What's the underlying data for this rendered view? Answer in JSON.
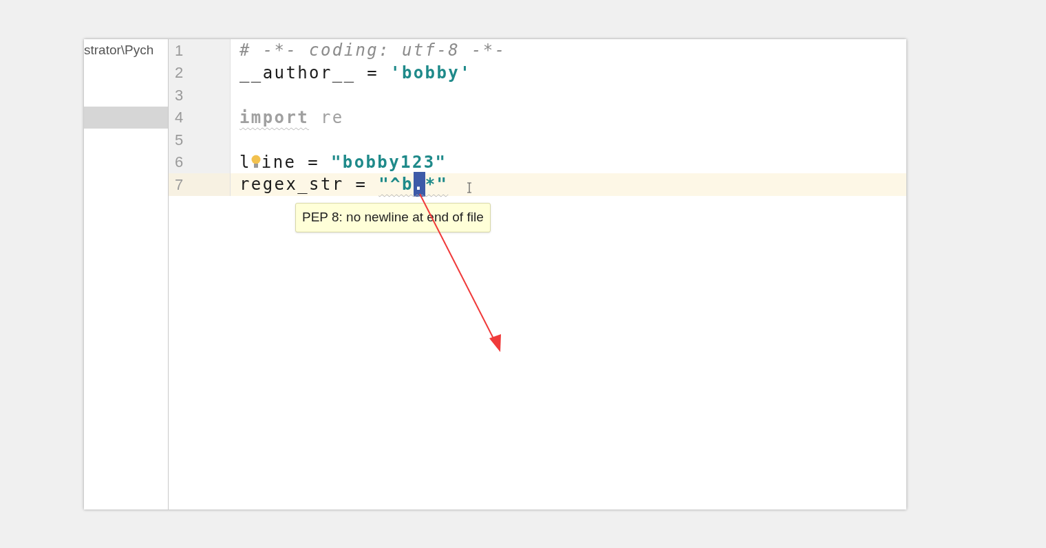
{
  "project_panel": {
    "rows": [
      {
        "label": "strator\\Pych",
        "selected": false
      },
      {
        "selected": true
      }
    ]
  },
  "editor": {
    "lines": [
      {
        "number": "1",
        "current": false,
        "tokens": [
          {
            "text": "# -*- coding: utf-8 -*-",
            "kind": "comment"
          }
        ]
      },
      {
        "number": "2",
        "current": false,
        "tokens": [
          {
            "text": "__author__ = ",
            "kind": "plain"
          },
          {
            "text": "'bobby'",
            "kind": "string"
          }
        ]
      },
      {
        "number": "3",
        "current": false
      },
      {
        "number": "4",
        "current": false,
        "tokens": [
          {
            "text": "import",
            "kind": "keyword",
            "warning": true
          },
          {
            "text": " re",
            "kind": "unused"
          }
        ]
      },
      {
        "number": "5",
        "current": false
      },
      {
        "number": "6",
        "current": false,
        "bulb": true,
        "tokens": [
          {
            "text": "l",
            "kind": "plain"
          },
          {
            "text": "ine = ",
            "kind": "plain"
          },
          {
            "text": "\"bobby123\"",
            "kind": "string"
          }
        ]
      },
      {
        "number": "7",
        "current": true,
        "tokens": [
          {
            "text": "regex_str = ",
            "kind": "plain"
          },
          {
            "text": "\"^b",
            "kind": "string",
            "warning": true
          },
          {
            "text": ".",
            "kind": "string",
            "warning": true,
            "selected": true
          },
          {
            "text": "*\"",
            "kind": "string",
            "warning": true
          }
        ]
      }
    ],
    "tooltip": "PEP 8: no newline at end of file"
  }
}
